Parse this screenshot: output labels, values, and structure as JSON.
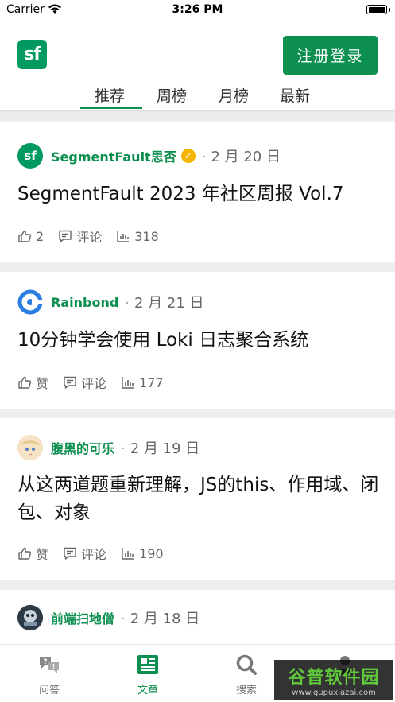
{
  "status_bar": {
    "carrier": "Carrier",
    "time": "3:26 PM"
  },
  "header": {
    "logo_text": "sf",
    "login_button": "注册登录"
  },
  "tabs": [
    {
      "label": "推荐",
      "active": true
    },
    {
      "label": "周榜",
      "active": false
    },
    {
      "label": "月榜",
      "active": false
    },
    {
      "label": "最新",
      "active": false
    }
  ],
  "posts": [
    {
      "author": "SegmentFault思否",
      "verified": true,
      "verified_icon": "check",
      "date": "2 月 20 日",
      "avatar_text": "sf",
      "avatar_color": "#009a61",
      "title": "SegmentFault 2023 年社区周报 Vol.7",
      "likes": "2",
      "comments": "评论",
      "views": "318"
    },
    {
      "author": "Rainbond",
      "verified": false,
      "date": "2 月 21 日",
      "avatar_color": "#2a7de1",
      "title": "10分钟学会使用 Loki 日志聚合系统",
      "likes": "赞",
      "comments": "评论",
      "views": "177"
    },
    {
      "author": "腹黑的可乐",
      "verified": false,
      "date": "2 月 19 日",
      "avatar_color": "#f3d7b7",
      "title": "从这两道题重新理解，JS的this、作用域、闭包、对象",
      "likes": "赞",
      "comments": "评论",
      "views": "190"
    },
    {
      "author": "前端扫地僧",
      "verified": false,
      "date": "2 月 18 日",
      "avatar_color": "#3a4a5a"
    }
  ],
  "bottom_nav": [
    {
      "label": "问答",
      "icon": "qa-icon",
      "active": false
    },
    {
      "label": "文章",
      "icon": "article-icon",
      "active": true
    },
    {
      "label": "搜索",
      "icon": "search-icon",
      "active": false
    },
    {
      "label": "",
      "icon": "profile-icon",
      "active": false
    }
  ],
  "watermark": {
    "main": "谷普软件园",
    "url": "www.gupuxiazai.com"
  },
  "colors": {
    "accent": "#0c8f4f",
    "brand": "#009a61",
    "separator": "#ebedef"
  }
}
